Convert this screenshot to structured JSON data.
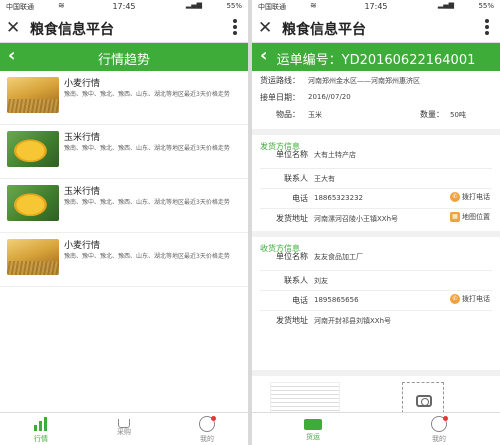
{
  "status": {
    "carrier": "中国联通",
    "time": "17:45",
    "battery": "55%"
  },
  "app": {
    "title": "粮食信息平台"
  },
  "left": {
    "header_title": "行情趋势",
    "items": [
      {
        "title": "小麦行情",
        "summary": "豫南、豫中、豫北、豫西、山东、湖北等地区最近3天价格走势",
        "image": "wheat"
      },
      {
        "title": "玉米行情",
        "summary": "豫南、豫中、豫北、豫西、山东、湖北等地区最近3天价格走势",
        "image": "corn"
      },
      {
        "title": "玉米行情",
        "summary": "豫南、豫中、豫北、豫西、山东、湖北等地区最近3天价格走势",
        "image": "corn"
      },
      {
        "title": "小麦行情",
        "summary": "豫南、豫中、豫北、豫西、山东、湖北等地区最近3天价格走势",
        "image": "wheat"
      }
    ],
    "nav": [
      {
        "label": "行情",
        "icon": "chart-icon",
        "active": true
      },
      {
        "label": "采购",
        "icon": "cart-icon",
        "active": false
      },
      {
        "label": "我的",
        "icon": "profile-icon",
        "active": false
      }
    ]
  },
  "right": {
    "header_title": "运单编号：YD20160622164001",
    "route_label": "货运路线：",
    "route_value": "河南郑州金水区——河南郑州惠济区",
    "date_label": "接单日期：",
    "date_value": "2016//07/20",
    "goods_label": "物品：",
    "goods_value": "玉米",
    "qty_label": "数量：",
    "qty_value": "50吨",
    "shipper": {
      "section": "发货方信息",
      "unit_label": "单位名称",
      "unit_value": "大有土特产店",
      "contact_label": "联系人",
      "contact_value": "王大有",
      "phone_label": "电话",
      "phone_value": "18865323232",
      "call_label": "拨打电话",
      "addr_label": "发货地址",
      "addr_value": "河南漯河召陵小王镇XXh号",
      "map_label": "地图位置"
    },
    "receiver": {
      "section": "收货方信息",
      "unit_label": "单位名称",
      "unit_value": "友友食品加工厂",
      "contact_label": "联系人",
      "contact_value": "刘友",
      "phone_label": "电话",
      "phone_value": "1895865656",
      "call_label": "拨打电话",
      "addr_label": "发货地址",
      "addr_value": "河南开封祁县刘镇XXh号"
    },
    "nav": [
      {
        "label": "货运",
        "icon": "truck-icon",
        "active": true
      },
      {
        "label": "我的",
        "icon": "profile-icon",
        "active": false
      }
    ]
  },
  "colors": {
    "accent": "#3dac38",
    "action": "#f2a23a",
    "badge": "#e53935"
  }
}
